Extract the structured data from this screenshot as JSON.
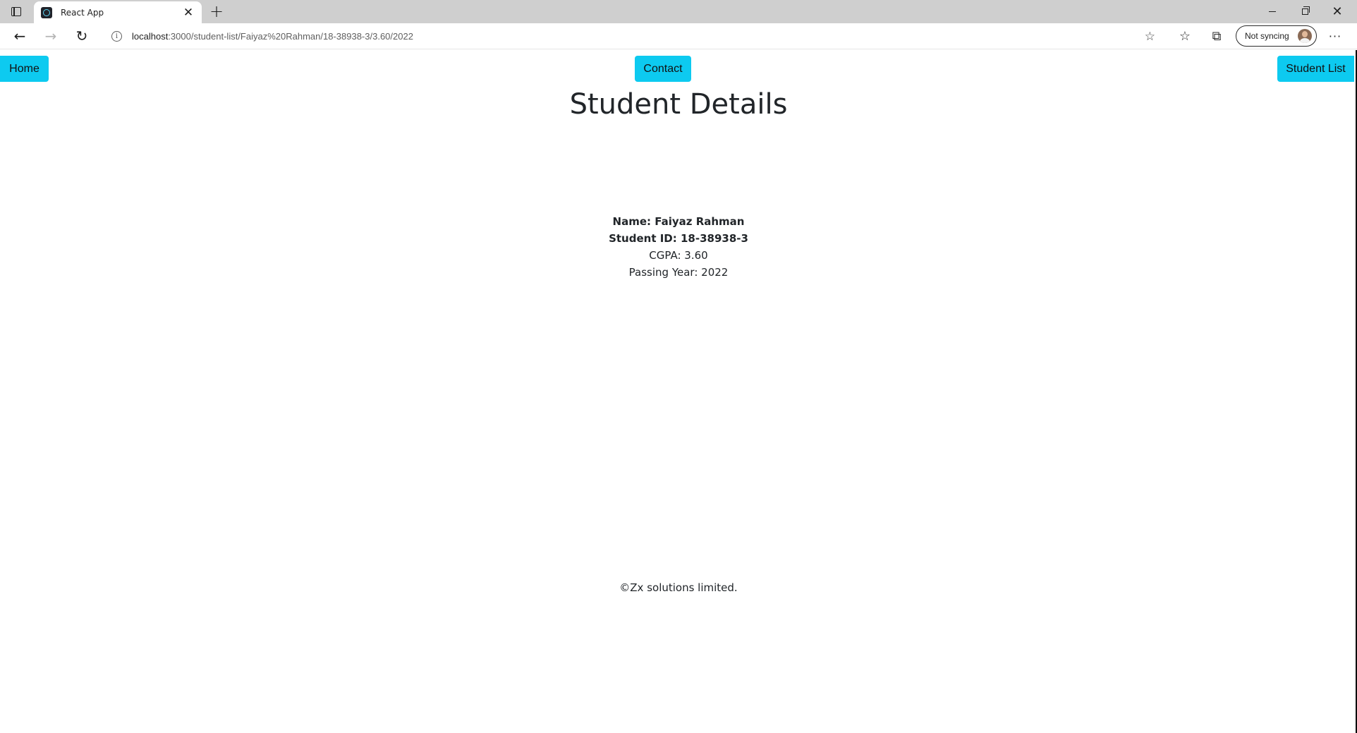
{
  "browser": {
    "tab_title": "React App",
    "new_tab_symbol": "+",
    "close_symbol": "✕",
    "url_host": "localhost",
    "url_path": ":3000/student-list/Faiyaz%20Rahman/18-38938-3/3.60/2022",
    "profile_label": "Not syncing",
    "icons": {
      "back": "←",
      "forward": "→",
      "reload": "↻",
      "info": "i",
      "favorite": "☆",
      "favorites": "☆",
      "collections": "⧉",
      "more": "···",
      "minimize": "minimize-icon",
      "maximize": "restore-icon",
      "window_close": "✕"
    }
  },
  "nav": {
    "home": "Home",
    "contact": "Contact",
    "student_list": "Student List"
  },
  "page": {
    "heading": "Student Details",
    "name_line": "Name: Faiyaz Rahman",
    "id_line": "Student ID: 18-38938-3",
    "cgpa_line": "CGPA: 3.60",
    "year_line": "Passing Year: 2022",
    "footer": "©Zx solutions limited."
  },
  "colors": {
    "button_bg": "#0dcaf0",
    "titlebar_bg": "#cfcfcf"
  }
}
